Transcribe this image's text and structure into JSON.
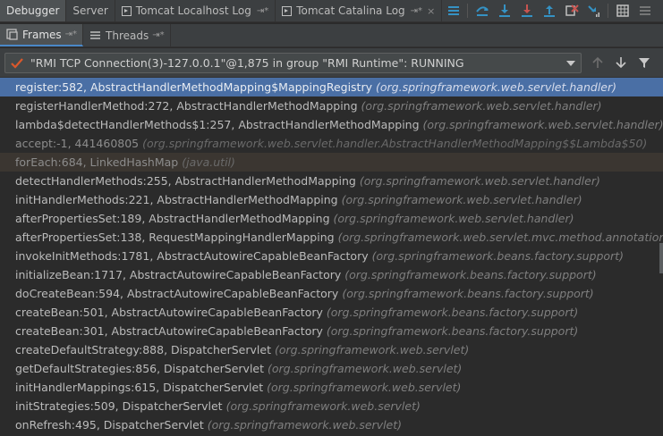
{
  "toolbar": {
    "tabs": [
      {
        "label": "Debugger",
        "active": true
      },
      {
        "label": "Server",
        "active": false
      },
      {
        "label": "Tomcat Localhost Log",
        "active": false
      },
      {
        "label": "Tomcat Catalina Log",
        "active": false
      }
    ],
    "pin_glyph": "⇥*",
    "close_glyph": "×"
  },
  "subtabs": {
    "frames_label": "Frames",
    "threads_label": "Threads",
    "pin_glyph": "⇥*"
  },
  "thread": {
    "selected": "\"RMI TCP Connection(3)-127.0.0.1\"@1,875 in group \"RMI Runtime\": RUNNING"
  },
  "frames": [
    {
      "method": "register:582, AbstractHandlerMethodMapping$MappingRegistry",
      "pkg": "(org.springframework.web.servlet.handler)",
      "state": "selected"
    },
    {
      "method": "registerHandlerMethod:272, AbstractHandlerMethodMapping",
      "pkg": "(org.springframework.web.servlet.handler)",
      "state": "normal"
    },
    {
      "method": "lambda$detectHandlerMethods$1:257, AbstractHandlerMethodMapping",
      "pkg": "(org.springframework.web.servlet.handler)",
      "state": "normal"
    },
    {
      "method": "accept:-1, 441460805",
      "pkg": "(org.springframework.web.servlet.handler.AbstractHandlerMethodMapping$$Lambda$50)",
      "state": "lib"
    },
    {
      "method": "forEach:684, LinkedHashMap",
      "pkg": "(java.util)",
      "state": "libhl"
    },
    {
      "method": "detectHandlerMethods:255, AbstractHandlerMethodMapping",
      "pkg": "(org.springframework.web.servlet.handler)",
      "state": "normal"
    },
    {
      "method": "initHandlerMethods:221, AbstractHandlerMethodMapping",
      "pkg": "(org.springframework.web.servlet.handler)",
      "state": "normal"
    },
    {
      "method": "afterPropertiesSet:189, AbstractHandlerMethodMapping",
      "pkg": "(org.springframework.web.servlet.handler)",
      "state": "normal"
    },
    {
      "method": "afterPropertiesSet:138, RequestMappingHandlerMapping",
      "pkg": "(org.springframework.web.servlet.mvc.method.annotation)",
      "state": "normal"
    },
    {
      "method": "invokeInitMethods:1781, AbstractAutowireCapableBeanFactory",
      "pkg": "(org.springframework.beans.factory.support)",
      "state": "normal"
    },
    {
      "method": "initializeBean:1717, AbstractAutowireCapableBeanFactory",
      "pkg": "(org.springframework.beans.factory.support)",
      "state": "normal"
    },
    {
      "method": "doCreateBean:594, AbstractAutowireCapableBeanFactory",
      "pkg": "(org.springframework.beans.factory.support)",
      "state": "normal"
    },
    {
      "method": "createBean:501, AbstractAutowireCapableBeanFactory",
      "pkg": "(org.springframework.beans.factory.support)",
      "state": "normal"
    },
    {
      "method": "createBean:301, AbstractAutowireCapableBeanFactory",
      "pkg": "(org.springframework.beans.factory.support)",
      "state": "normal"
    },
    {
      "method": "createDefaultStrategy:888, DispatcherServlet",
      "pkg": "(org.springframework.web.servlet)",
      "state": "normal"
    },
    {
      "method": "getDefaultStrategies:856, DispatcherServlet",
      "pkg": "(org.springframework.web.servlet)",
      "state": "normal"
    },
    {
      "method": "initHandlerMappings:615, DispatcherServlet",
      "pkg": "(org.springframework.web.servlet)",
      "state": "normal"
    },
    {
      "method": "initStrategies:509, DispatcherServlet",
      "pkg": "(org.springframework.web.servlet)",
      "state": "normal"
    },
    {
      "method": "onRefresh:495, DispatcherServlet",
      "pkg": "(org.springframework.web.servlet)",
      "state": "normal"
    }
  ],
  "colors": {
    "selection": "#4a6fa5",
    "accent_blue": "#3592c4",
    "accent_red": "#c75450",
    "check_orange": "#d9582c"
  }
}
